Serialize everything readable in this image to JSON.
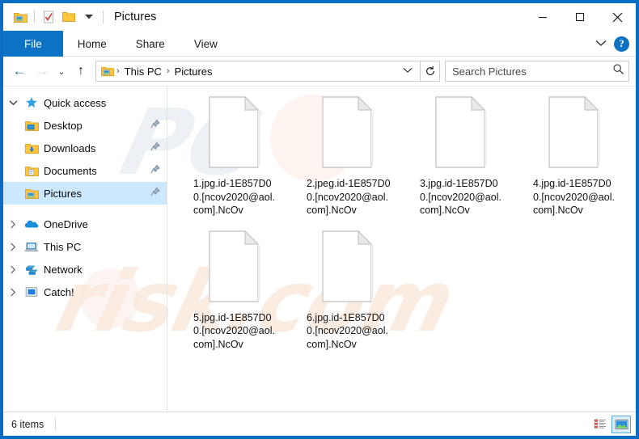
{
  "window": {
    "title": "Pictures",
    "border_color": "#0a6cc4",
    "accent_color": "#0c72c4"
  },
  "quick_access_toolbar": {
    "items": [
      {
        "name": "pictures-folder-icon",
        "tooltip": "Pictures"
      },
      {
        "name": "properties-icon",
        "tooltip": "Properties"
      },
      {
        "name": "new-folder-icon",
        "tooltip": "New folder"
      },
      {
        "name": "customize-dropdown-icon",
        "tooltip": "Customize Quick Access Toolbar"
      }
    ]
  },
  "window_controls": {
    "minimize": "—",
    "maximize": "☐",
    "close": "✕"
  },
  "ribbon": {
    "tabs": [
      {
        "label": "File",
        "active": true
      },
      {
        "label": "Home",
        "active": false
      },
      {
        "label": "Share",
        "active": false
      },
      {
        "label": "View",
        "active": false
      }
    ],
    "expand_icon": "chevron-down-icon",
    "help_label": "?"
  },
  "address_bar": {
    "back_icon": "←",
    "forward_icon": "→",
    "recent_icon": "⌄",
    "up_icon": "↑",
    "breadcrumb": [
      "This PC",
      "Pictures"
    ],
    "breadcrumb_separator": "›",
    "dropdown_icon": "⌄",
    "refresh_icon": "↻"
  },
  "search": {
    "placeholder": "Search Pictures",
    "value": "",
    "icon": "search-icon"
  },
  "sidebar": {
    "items": [
      {
        "label": "Quick access",
        "icon": "star-icon",
        "level": 0,
        "expanded": true,
        "chevron": "⌄",
        "pinned": false,
        "selected": false
      },
      {
        "label": "Desktop",
        "icon": "desktop-folder-icon",
        "level": 1,
        "pinned": true,
        "selected": false
      },
      {
        "label": "Downloads",
        "icon": "downloads-folder-icon",
        "level": 1,
        "pinned": true,
        "selected": false
      },
      {
        "label": "Documents",
        "icon": "documents-folder-icon",
        "level": 1,
        "pinned": true,
        "selected": false
      },
      {
        "label": "Pictures",
        "icon": "pictures-folder-icon",
        "level": 1,
        "pinned": true,
        "selected": true
      },
      {
        "label": "OneDrive",
        "icon": "onedrive-cloud-icon",
        "level": 0,
        "expanded": false,
        "chevron": "›",
        "pinned": false,
        "selected": false
      },
      {
        "label": "This PC",
        "icon": "this-pc-icon",
        "level": 0,
        "expanded": false,
        "chevron": "›",
        "pinned": false,
        "selected": false
      },
      {
        "label": "Network",
        "icon": "network-icon",
        "level": 0,
        "expanded": false,
        "chevron": "›",
        "pinned": false,
        "selected": false
      },
      {
        "label": "Catch!",
        "icon": "catch-drive-icon",
        "level": 0,
        "expanded": false,
        "chevron": "›",
        "pinned": false,
        "selected": false
      }
    ]
  },
  "files": [
    {
      "name": "1.jpg.id-1E857D00.[ncov2020@aol.com].NcOv",
      "icon": "blank-document-icon"
    },
    {
      "name": "2.jpeg.id-1E857D00.[ncov2020@aol.com].NcOv",
      "icon": "blank-document-icon"
    },
    {
      "name": "3.jpg.id-1E857D00.[ncov2020@aol.com].NcOv",
      "icon": "blank-document-icon"
    },
    {
      "name": "4.jpg.id-1E857D00.[ncov2020@aol.com].NcOv",
      "icon": "blank-document-icon"
    },
    {
      "name": "5.jpg.id-1E857D00.[ncov2020@aol.com].NcOv",
      "icon": "blank-document-icon"
    },
    {
      "name": "6.jpg.id-1E857D00.[ncov2020@aol.com].NcOv",
      "icon": "blank-document-icon"
    }
  ],
  "status_bar": {
    "item_count": "6 items",
    "views": [
      {
        "name": "details-view-button",
        "active": false
      },
      {
        "name": "large-icons-view-button",
        "active": true
      }
    ]
  },
  "watermark": {
    "text_top": "PC",
    "text_bottom": "risk.com"
  }
}
